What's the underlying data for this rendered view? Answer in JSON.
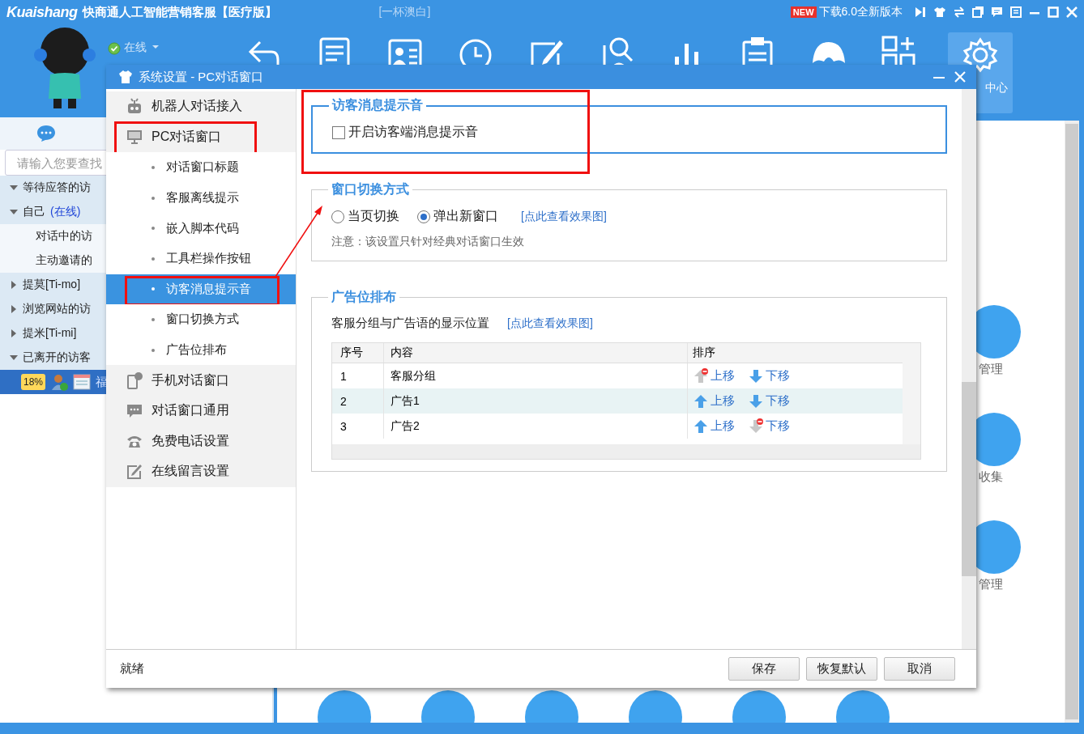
{
  "app": {
    "brand": "Kuaishang",
    "title": "快商通人工智能营销客服【医疗版】",
    "account": "[一杯澳白]",
    "new_badge": "NEW",
    "update_link": "下载6.0全新版本",
    "status": "在线",
    "settings_tile": "中心"
  },
  "sidebar": {
    "search_placeholder": "请输入您要查找",
    "tree": [
      {
        "kind": "group",
        "label": "等待应答的访",
        "expanded": true
      },
      {
        "kind": "group",
        "label": "自己",
        "status": "(在线)",
        "expanded": true,
        "children": [
          {
            "kind": "leaf",
            "label": "对话中的访"
          },
          {
            "kind": "leaf",
            "label": "主动邀请的"
          }
        ]
      },
      {
        "kind": "group",
        "label": "提莫[Ti-mo]",
        "expanded": false
      },
      {
        "kind": "group",
        "label": "浏览网站的访",
        "expanded": false
      },
      {
        "kind": "group",
        "label": "提米[Ti-mi]",
        "expanded": false
      },
      {
        "kind": "group",
        "label": "已离开的访客",
        "expanded": true,
        "children": [
          {
            "kind": "visitor",
            "badge": "18%",
            "label": "福",
            "selected": true
          }
        ]
      }
    ]
  },
  "features": [
    "管理",
    "收集",
    "管理"
  ],
  "dialog": {
    "title": "系统设置 - PC对话窗口",
    "annotation_arrow": true,
    "nav": [
      {
        "label": "机器人对话接入",
        "selected": false,
        "annotated": false
      },
      {
        "label": "PC对话窗口",
        "selected": false,
        "annotated": true,
        "children": [
          {
            "label": "对话窗口标题",
            "selected": false,
            "annotated": false
          },
          {
            "label": "客服离线提示",
            "selected": false,
            "annotated": false
          },
          {
            "label": "嵌入脚本代码",
            "selected": false,
            "annotated": false
          },
          {
            "label": "工具栏操作按钮",
            "selected": false,
            "annotated": false
          },
          {
            "label": "访客消息提示音",
            "selected": true,
            "annotated": true
          },
          {
            "label": "窗口切换方式",
            "selected": false,
            "annotated": false
          },
          {
            "label": "广告位排布",
            "selected": false,
            "annotated": false
          }
        ]
      },
      {
        "label": "手机对话窗口",
        "selected": false,
        "annotated": false
      },
      {
        "label": "对话窗口通用",
        "selected": false,
        "annotated": false
      },
      {
        "label": "免费电话设置",
        "selected": false,
        "annotated": false
      },
      {
        "label": "在线留言设置",
        "selected": false,
        "annotated": false
      }
    ],
    "groups": [
      {
        "kind": "checkboxes",
        "title": "访客消息提示音",
        "focused": true,
        "annotated": true,
        "options": [
          {
            "label": "开启访客端消息提示音",
            "checked": false
          }
        ]
      },
      {
        "kind": "radios",
        "title": "窗口切换方式",
        "focused": false,
        "annotated": false,
        "options": [
          {
            "label": "当页切换",
            "selected": false
          },
          {
            "label": "弹出新窗口",
            "selected": true
          }
        ],
        "link": "[点此查看效果图]",
        "note": "注意：该设置只针对经典对话窗口生效"
      },
      {
        "kind": "table",
        "title": "广告位排布",
        "focused": false,
        "annotated": false,
        "caption": "客服分组与广告语的显示位置",
        "link": "[点此查看效果图]",
        "columns": [
          "序号",
          "内容",
          "排序"
        ],
        "rows": [
          {
            "index": "1",
            "content": "客服分组",
            "up": "上移",
            "up_disabled": true,
            "down": "下移",
            "down_disabled": false,
            "selected": false
          },
          {
            "index": "2",
            "content": "广告1",
            "up": "上移",
            "up_disabled": false,
            "down": "下移",
            "down_disabled": false,
            "selected": true
          },
          {
            "index": "3",
            "content": "广告2",
            "up": "上移",
            "up_disabled": false,
            "down": "下移",
            "down_disabled": true,
            "selected": false
          }
        ]
      }
    ],
    "status": "就绪",
    "buttons": [
      "保存",
      "恢复默认",
      "取消"
    ]
  }
}
